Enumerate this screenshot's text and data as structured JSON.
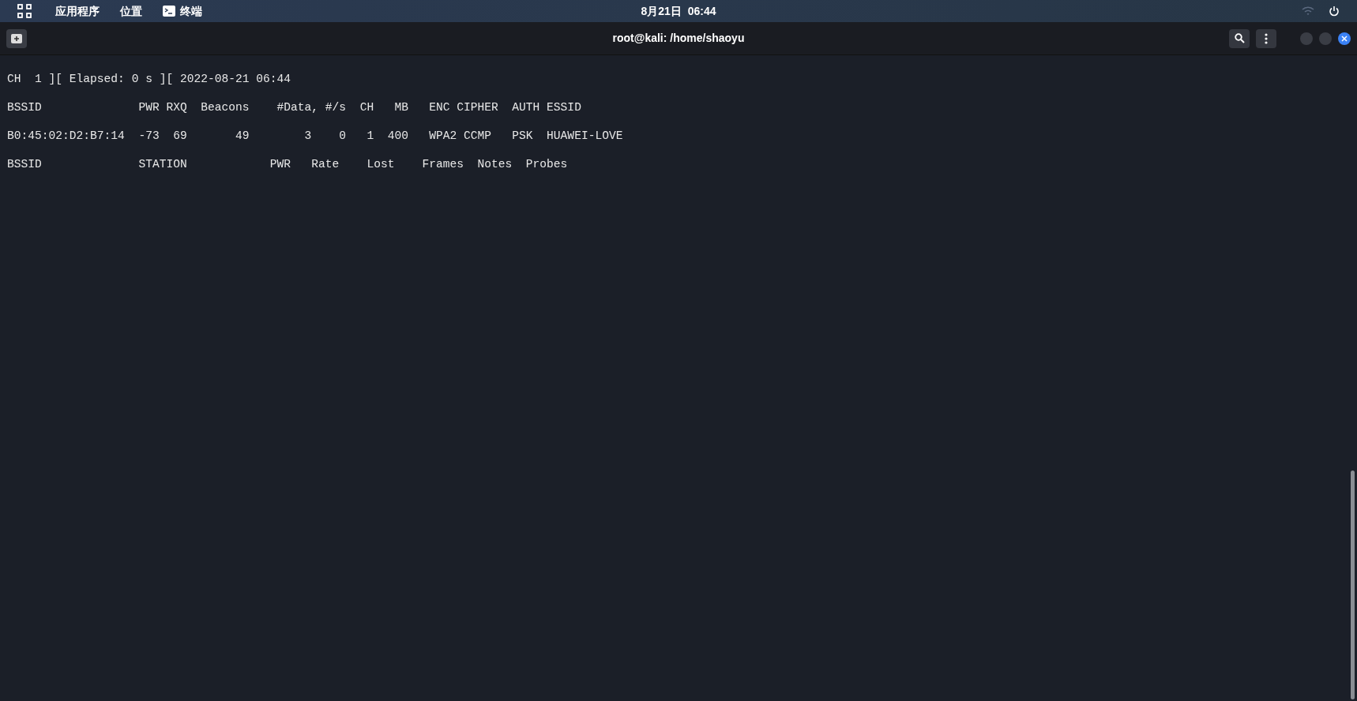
{
  "top_bar": {
    "menus": [
      {
        "kind": "plain",
        "label": "应用程序"
      },
      {
        "kind": "plain",
        "label": "位置"
      },
      {
        "kind": "terminal",
        "label": "终端"
      }
    ],
    "clock": "8月21日  06:44"
  },
  "window": {
    "title": "root@kali: /home/shaoyu"
  },
  "terminal": {
    "lines": [
      "CH  1 ][ Elapsed: 0 s ][ 2022-08-21 06:44",
      "BSSID              PWR RXQ  Beacons    #Data, #/s  CH   MB   ENC CIPHER  AUTH ESSID",
      "B0:45:02:D2:B7:14  -73  69       49        3    0   1  400   WPA2 CCMP   PSK  HUAWEI-LOVE",
      "BSSID              STATION            PWR   Rate    Lost    Frames  Notes  Probes"
    ]
  }
}
